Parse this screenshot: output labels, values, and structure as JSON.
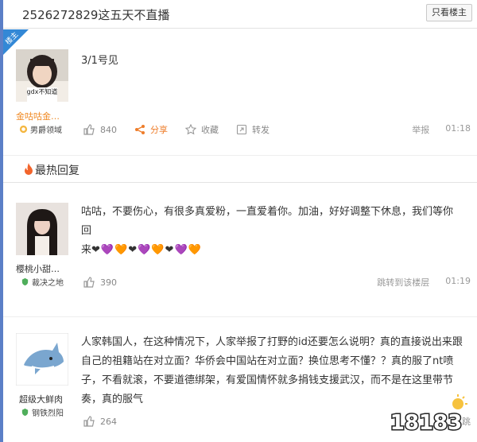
{
  "header": {
    "title": "2526272829这五天不直播",
    "only_op_label": "只看楼主"
  },
  "main_post": {
    "op_tag": "楼主",
    "author": "金咕咕金…",
    "badge": "男爵领域",
    "avatar_caption": "gdx不知道",
    "text": "3/1号见",
    "like_count": "840",
    "share_label": "分享",
    "collect_label": "收藏",
    "repost_label": "转发",
    "report_label": "举报",
    "time": "01:18"
  },
  "hot_section": {
    "title": "最热回复"
  },
  "replies": [
    {
      "author": "樱桃小甜…",
      "badge": "裁决之地",
      "text_line1": "咕咕，不要伤心，有很多真爱粉，一直爱着你。加油，好好调整下休息，我们等你回",
      "text_line2": "来",
      "hearts": "❤💜🧡❤💜🧡❤💜🧡",
      "like_count": "390",
      "jump_label": "跳转到该楼层",
      "time": "01:19"
    },
    {
      "author": "超级大鲜肉",
      "badge": "钢铁烈阳",
      "text_line1": "人家韩国人，在这种情况下，人家举报了打野的id还要怎么说明？真的直接说出来跟",
      "text_line2": "自己的祖籍站在对立面？华侨会中国站在对立面？换位思考不懂？？真的服了nt喷",
      "text_line3": "子，不看就滚，不要道德绑架，有爱国情怀就多捐钱支援武汉，而不是在这里带节",
      "text_line4": "奏，真的服气",
      "like_count": "264",
      "jump_label": "跳"
    }
  ],
  "watermark": {
    "text": "18183"
  },
  "colors": {
    "accent_blue": "#3388d6",
    "share_orange": "#ee7d2a",
    "name_orange": "#f08a24"
  }
}
